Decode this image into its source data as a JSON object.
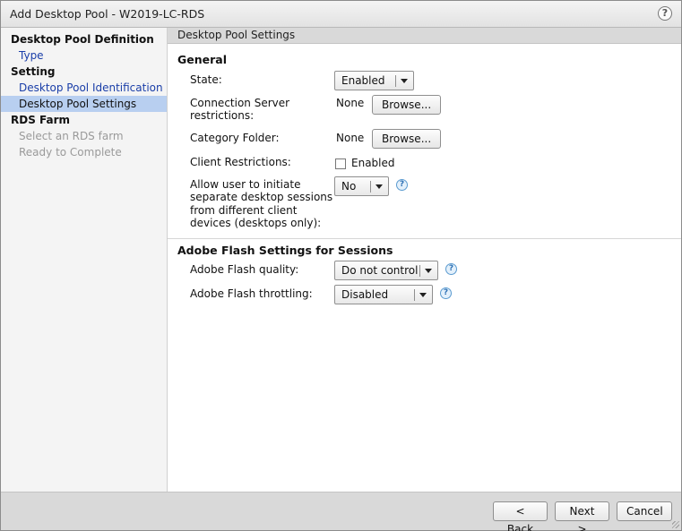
{
  "window": {
    "title": "Add Desktop Pool - W2019-LC-RDS",
    "help_glyph": "?"
  },
  "sidebar": {
    "items": [
      {
        "label": "Desktop Pool Definition",
        "kind": "head"
      },
      {
        "label": "Type",
        "kind": "link"
      },
      {
        "label": "Setting",
        "kind": "head"
      },
      {
        "label": "Desktop Pool Identification",
        "kind": "link"
      },
      {
        "label": "Desktop Pool Settings",
        "kind": "selected"
      },
      {
        "label": "RDS Farm",
        "kind": "head"
      },
      {
        "label": "Select an RDS farm",
        "kind": "disabled"
      },
      {
        "label": "Ready to Complete",
        "kind": "disabled"
      }
    ]
  },
  "content": {
    "section_title": "Desktop Pool Settings",
    "general": {
      "title": "General",
      "state": {
        "label": "State:",
        "value": "Enabled"
      },
      "connection_server": {
        "label_line1": "Connection Server",
        "label_line2": "restrictions:",
        "value": "None",
        "button": "Browse..."
      },
      "category_folder": {
        "label": "Category Folder:",
        "value": "None",
        "button": "Browse..."
      },
      "client_restrictions": {
        "label": "Client Restrictions:",
        "checkbox_label": "Enabled",
        "checked": false
      },
      "allow_sessions": {
        "label_line1": "Allow user to initiate",
        "label_line2": "separate desktop sessions",
        "label_line3": "from different client",
        "label_line4": "devices (desktops only):",
        "value": "No"
      }
    },
    "flash": {
      "title": "Adobe Flash Settings for Sessions",
      "quality": {
        "label": "Adobe Flash quality:",
        "value": "Do not control"
      },
      "throttling": {
        "label": "Adobe Flash throttling:",
        "value": "Disabled"
      }
    },
    "help_glyph": "?"
  },
  "footer": {
    "back": "< Back",
    "next": "Next >",
    "cancel": "Cancel"
  },
  "icons": {
    "help": "help-icon",
    "dropdown": "chevron-down-icon",
    "grip": "resize-grip-icon"
  }
}
